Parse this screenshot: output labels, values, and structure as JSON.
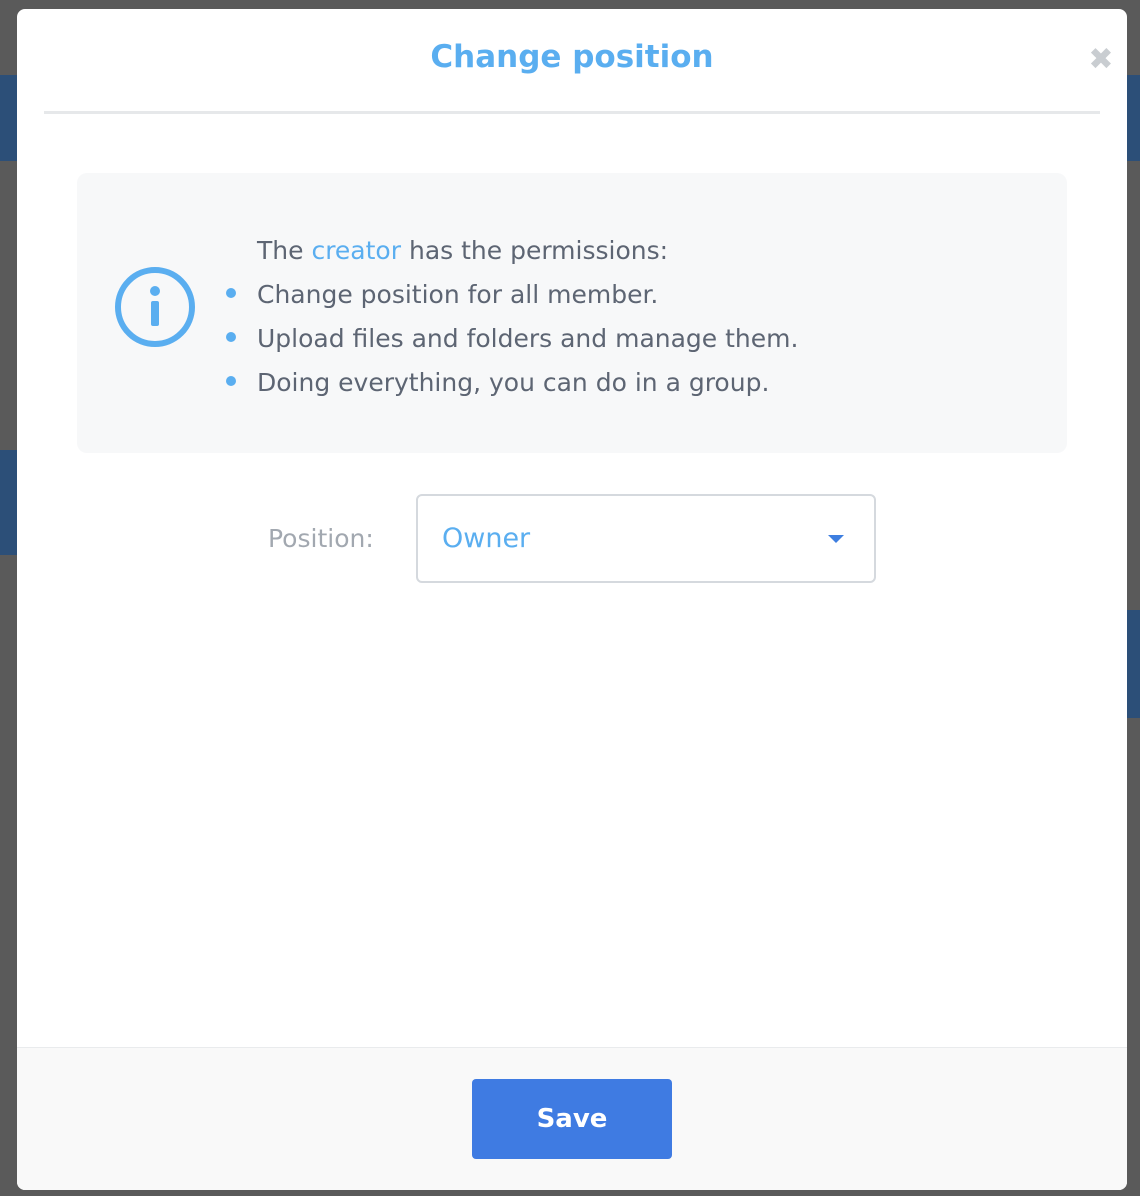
{
  "modal": {
    "title": "Change position",
    "close_symbol": "✖"
  },
  "info": {
    "icon": "info-circle-icon",
    "intro_prefix": "The",
    "intro_role": "creator",
    "intro_suffix": "has the permissions:",
    "permissions": [
      "Change position for all member.",
      "Upload files and folders and manage them.",
      "Doing everything, you can do in a group."
    ]
  },
  "position": {
    "label": "Position:",
    "selected": "Owner"
  },
  "footer": {
    "save_label": "Save"
  },
  "colors": {
    "accent": "#5aaef0",
    "button": "#3f7be2",
    "text": "#5d6573"
  }
}
